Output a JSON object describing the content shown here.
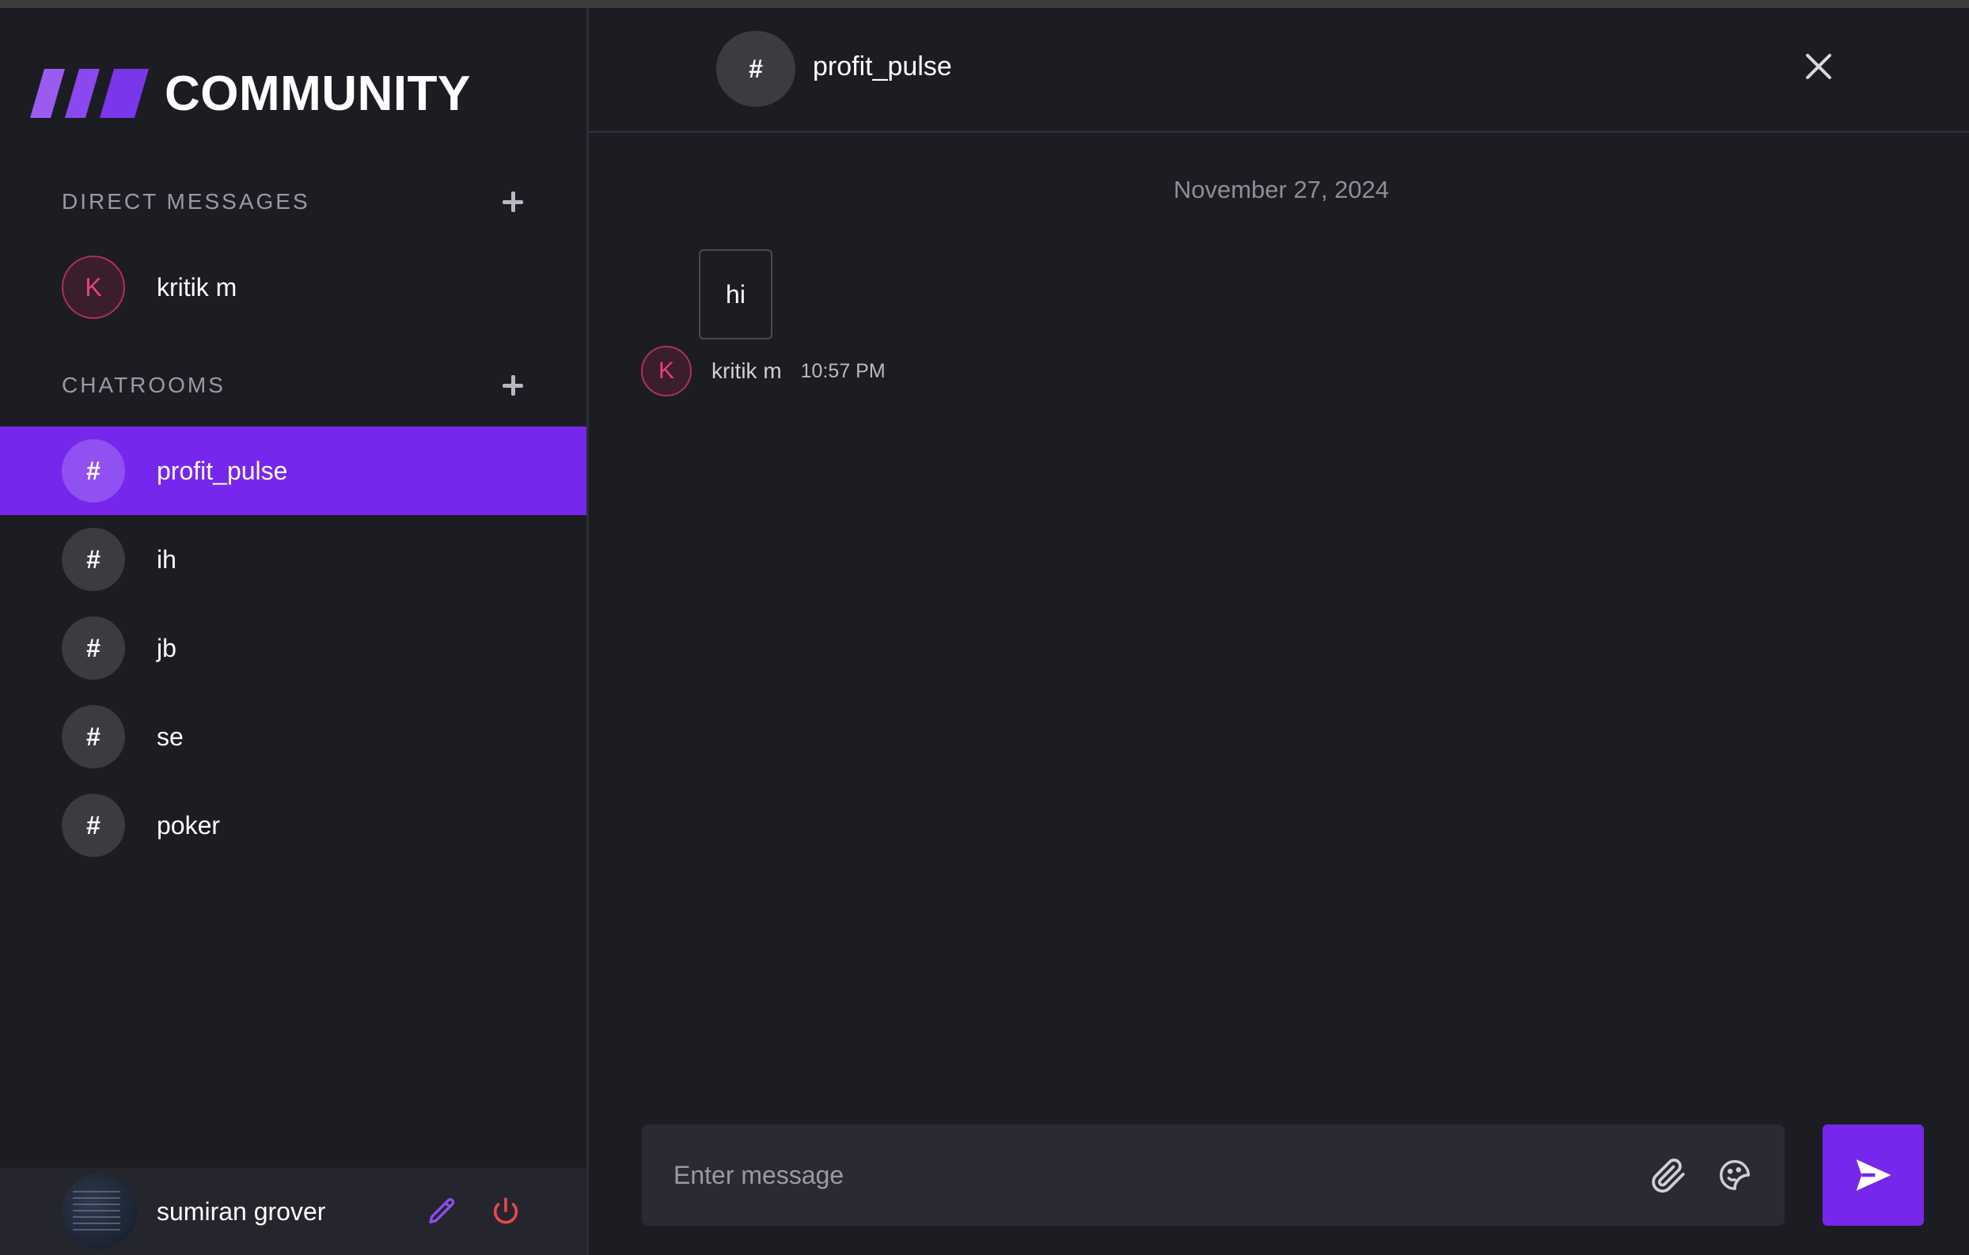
{
  "app": {
    "brand": "COMMUNITY"
  },
  "sidebar": {
    "direct_messages": {
      "title": "DIRECT MESSAGES",
      "items": [
        {
          "initial": "K",
          "name": "kritik m"
        }
      ]
    },
    "chatrooms": {
      "title": "CHATROOMS",
      "items": [
        {
          "symbol": "#",
          "name": "profit_pulse",
          "active": true
        },
        {
          "symbol": "#",
          "name": "ih"
        },
        {
          "symbol": "#",
          "name": "jb"
        },
        {
          "symbol": "#",
          "name": "se"
        },
        {
          "symbol": "#",
          "name": "poker"
        }
      ]
    },
    "user": {
      "name": "sumiran grover"
    }
  },
  "chat": {
    "header": {
      "symbol": "#",
      "name": "profit_pulse"
    },
    "date_separator": "November 27, 2024",
    "messages": [
      {
        "text": "hi",
        "author_initial": "K",
        "author": "kritik m",
        "time": "10:57 PM"
      }
    ],
    "composer": {
      "placeholder": "Enter message"
    }
  },
  "colors": {
    "accent": "#7627eb",
    "background": "#1c1c23",
    "dm_avatar": "#e8417c",
    "logout": "#e5484d"
  },
  "icons": {
    "add": "plus-icon",
    "close": "close-icon",
    "edit": "pencil-icon",
    "logout": "power-icon",
    "attach": "paperclip-icon",
    "sticker": "sticker-icon",
    "send": "send-icon"
  }
}
